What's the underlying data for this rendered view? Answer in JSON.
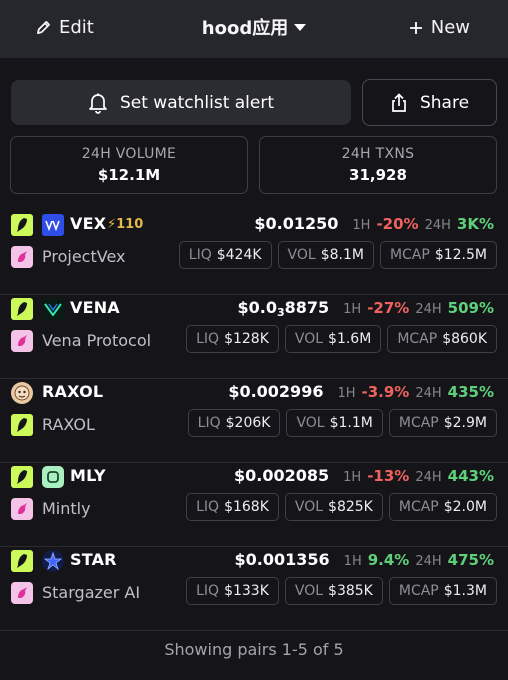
{
  "header": {
    "edit_label": "Edit",
    "title": "hood应用",
    "new_label": "New"
  },
  "actions": {
    "alert_label": "Set watchlist alert",
    "share_label": "Share"
  },
  "stats": [
    {
      "label": "24H VOLUME",
      "value": "$12.1M"
    },
    {
      "label": "24H TXNS",
      "value": "31,928"
    }
  ],
  "pairs": [
    {
      "symbol": "VEX",
      "boost": "110",
      "name": "ProjectVex",
      "price": "$0.01250",
      "h1_label": "1H",
      "h1": "-20%",
      "h24_label": "24H",
      "h24": "3K%",
      "liq_label": "LIQ",
      "liq": "$424K",
      "vol_label": "VOL",
      "vol": "$8.1M",
      "mcap_label": "MCAP",
      "mcap": "$12.5M"
    },
    {
      "symbol": "VENA",
      "boost": "",
      "name": "Vena Protocol",
      "price_prefix": "$0.0",
      "price_sub": "3",
      "price_suffix": "8875",
      "h1_label": "1H",
      "h1": "-27%",
      "h24_label": "24H",
      "h24": "509%",
      "liq_label": "LIQ",
      "liq": "$128K",
      "vol_label": "VOL",
      "vol": "$1.6M",
      "mcap_label": "MCAP",
      "mcap": "$860K"
    },
    {
      "symbol": "RAXOL",
      "boost": "",
      "name": "RAXOL",
      "price": "$0.002996",
      "h1_label": "1H",
      "h1": "-3.9%",
      "h24_label": "24H",
      "h24": "435%",
      "liq_label": "LIQ",
      "liq": "$206K",
      "vol_label": "VOL",
      "vol": "$1.1M",
      "mcap_label": "MCAP",
      "mcap": "$2.9M"
    },
    {
      "symbol": "MLY",
      "boost": "",
      "name": "Mintly",
      "price": "$0.002085",
      "h1_label": "1H",
      "h1": "-13%",
      "h24_label": "24H",
      "h24": "443%",
      "liq_label": "LIQ",
      "liq": "$168K",
      "vol_label": "VOL",
      "vol": "$825K",
      "mcap_label": "MCAP",
      "mcap": "$2.0M"
    },
    {
      "symbol": "STAR",
      "boost": "",
      "name": "Stargazer AI",
      "price": "$0.001356",
      "h1_label": "1H",
      "h1": "9.4%",
      "h24_label": "24H",
      "h24": "475%",
      "liq_label": "LIQ",
      "liq": "$133K",
      "vol_label": "VOL",
      "vol": "$385K",
      "mcap_label": "MCAP",
      "mcap": "$1.3M"
    }
  ],
  "footer": {
    "text": "Showing pairs 1-5 of 5"
  },
  "colors": {
    "positive": "#5fd07a",
    "negative": "#f0625d",
    "boost": "#e4b849",
    "chain": "#cdfa5b"
  }
}
